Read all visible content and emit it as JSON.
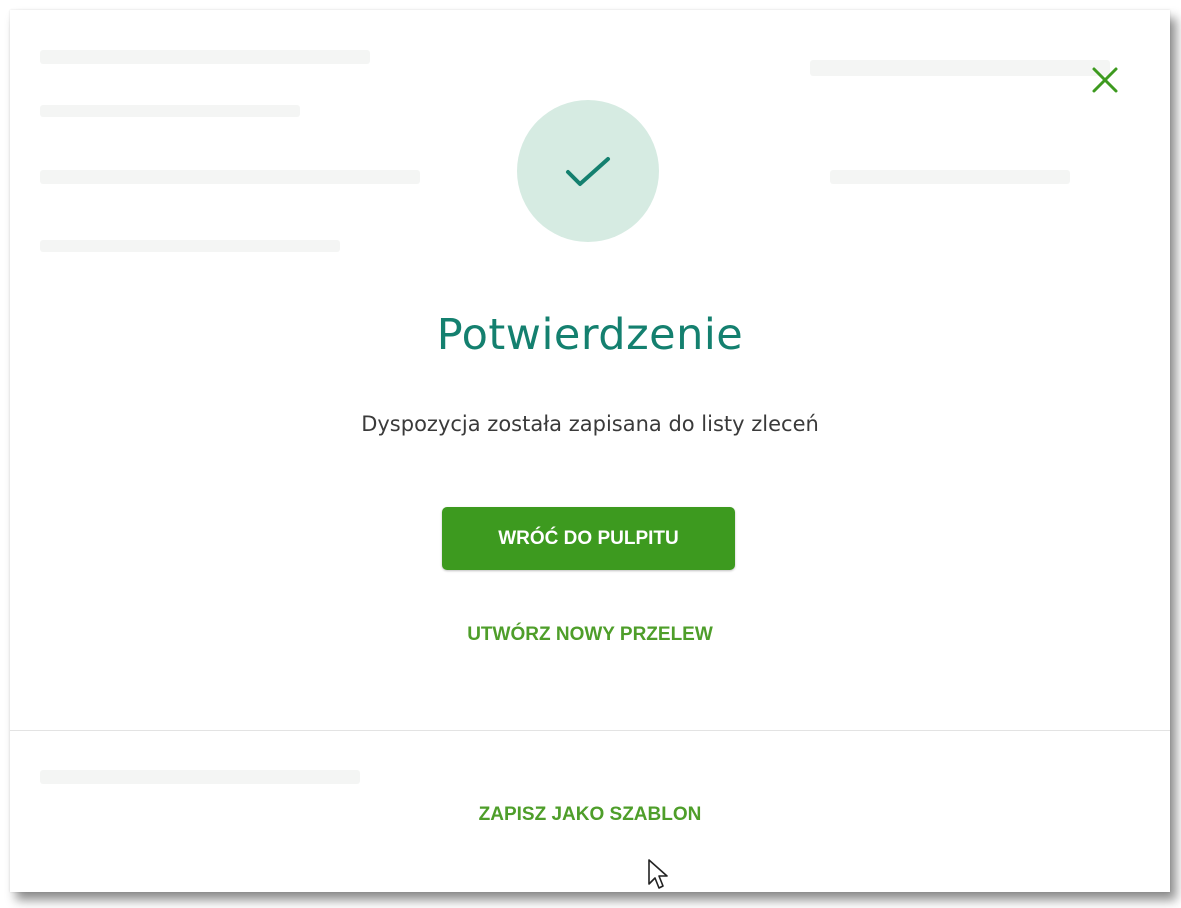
{
  "dialog": {
    "title": "Potwierdzenie",
    "message": "Dyspozycja została zapisana do listy zleceń",
    "primary_button_label": "WRÓĆ DO PULPITU",
    "new_transfer_label": "UTWÓRZ NOWY PRZELEW",
    "save_template_label": "ZAPISZ JAKO SZABLON",
    "close_icon": "close-icon",
    "success_icon": "checkmark-icon"
  },
  "colors": {
    "accent_green": "#3d9a1f",
    "title_teal": "#14806f",
    "success_circle_bg": "#d6ebe2",
    "link_green": "#4e9e2a"
  }
}
